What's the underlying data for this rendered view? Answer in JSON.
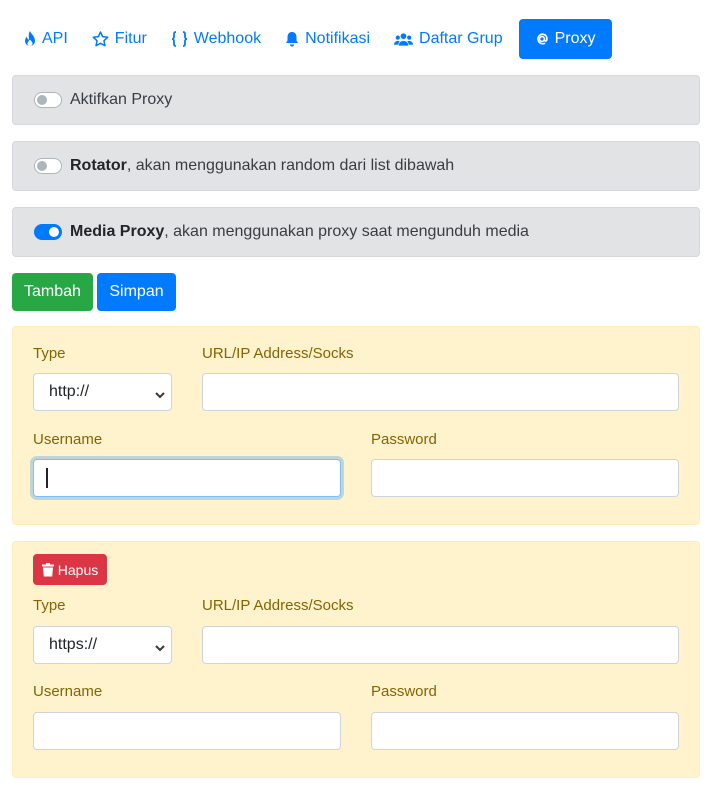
{
  "tabs": [
    {
      "label": "API",
      "icon": "fire-icon"
    },
    {
      "label": "Fitur",
      "icon": "star-icon"
    },
    {
      "label": "Webhook",
      "icon": "braces-icon"
    },
    {
      "label": "Notifikasi",
      "icon": "bell-icon"
    },
    {
      "label": "Daftar Grup",
      "icon": "users-icon"
    },
    {
      "label": "Proxy",
      "icon": "at-icon",
      "active": true
    }
  ],
  "toggles": {
    "enable": {
      "label": "Aktifkan Proxy",
      "on": false
    },
    "rotator": {
      "bold": "Rotator",
      "label": ", akan menggunakan random dari list dibawah",
      "on": false
    },
    "media": {
      "bold": "Media Proxy",
      "label": ", akan menggunakan proxy saat mengunduh media",
      "on": true
    }
  },
  "actions": {
    "add_label": "Tambah",
    "save_label": "Simpan"
  },
  "proxies": [
    {
      "type_label": "Type",
      "type_value": "http://",
      "url_label": "URL/IP Address/Socks",
      "url_value": "",
      "username_label": "Username",
      "username_value": "",
      "password_label": "Password",
      "password_value": ""
    },
    {
      "delete_label": "Hapus",
      "type_label": "Type",
      "type_value": "https://",
      "url_label": "URL/IP Address/Socks",
      "url_value": "",
      "username_label": "Username",
      "username_value": "",
      "password_label": "Password",
      "password_value": ""
    }
  ],
  "colors": {
    "primary": "#007bff",
    "success": "#28a745",
    "danger": "#dc3545",
    "warning_bg": "#fff3cd",
    "secondary_bg": "#e2e3e5"
  }
}
